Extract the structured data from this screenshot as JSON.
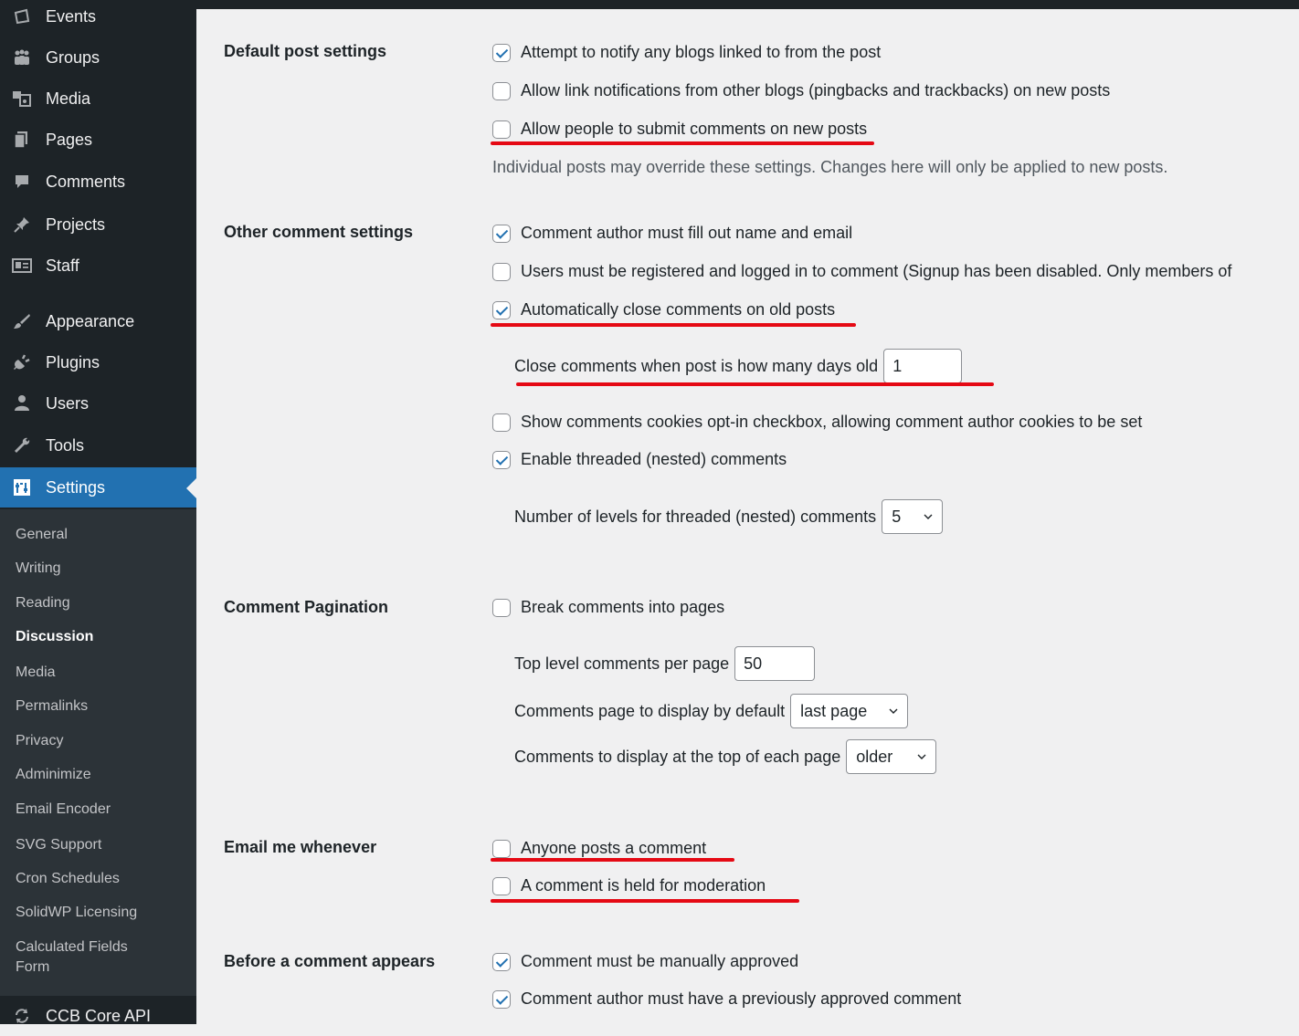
{
  "sidebar": {
    "items": [
      {
        "label": "Events",
        "icon": "calendar-icon"
      },
      {
        "label": "Groups",
        "icon": "groups-icon"
      },
      {
        "label": "Media",
        "icon": "media-icon"
      },
      {
        "label": "Pages",
        "icon": "pages-icon"
      },
      {
        "label": "Comments",
        "icon": "comments-icon"
      },
      {
        "label": "Projects",
        "icon": "pin-icon"
      },
      {
        "label": "Staff",
        "icon": "id-card-icon"
      },
      {
        "label": "Appearance",
        "icon": "paintbrush-icon"
      },
      {
        "label": "Plugins",
        "icon": "plugin-icon"
      },
      {
        "label": "Users",
        "icon": "user-icon"
      },
      {
        "label": "Tools",
        "icon": "wrench-icon"
      },
      {
        "label": "Settings",
        "icon": "settings-icon"
      },
      {
        "label": "CCB Core API",
        "icon": "sync-icon"
      }
    ],
    "submenu": [
      "General",
      "Writing",
      "Reading",
      "Discussion",
      "Media",
      "Permalinks",
      "Privacy",
      "Adminimize",
      "Email Encoder",
      "SVG Support",
      "Cron Schedules",
      "SolidWP Licensing",
      "Calculated Fields",
      "Form"
    ],
    "active_item": "Settings",
    "current_sub": "Discussion"
  },
  "sections": {
    "default_post": {
      "title": "Default post settings",
      "opt1": "Attempt to notify any blogs linked to from the post",
      "opt2": "Allow link notifications from other blogs (pingbacks and trackbacks) on new posts",
      "opt3": "Allow people to submit comments on new posts",
      "desc": "Individual posts may override these settings. Changes here will only be applied to new posts."
    },
    "other": {
      "title": "Other comment settings",
      "opt1": "Comment author must fill out name and email",
      "opt2": "Users must be registered and logged in to comment (Signup has been disabled. Only members of",
      "opt3": "Automatically close comments on old posts",
      "close_label": "Close comments when post is how many days old",
      "close_value": "1",
      "opt4": "Show comments cookies opt-in checkbox, allowing comment author cookies to be set",
      "opt5": "Enable threaded (nested) comments",
      "levels_label": "Number of levels for threaded (nested) comments",
      "levels_value": "5"
    },
    "pagination": {
      "title": "Comment Pagination",
      "opt1": "Break comments into pages",
      "per_page_label": "Top level comments per page",
      "per_page_value": "50",
      "default_page_label": "Comments page to display by default",
      "default_page_value": "last page",
      "top_label": "Comments to display at the top of each page",
      "top_value": "older"
    },
    "email": {
      "title": "Email me whenever",
      "opt1": "Anyone posts a comment",
      "opt2": "A comment is held for moderation"
    },
    "before": {
      "title": "Before a comment appears",
      "opt1": "Comment must be manually approved",
      "opt2": "Comment author must have a previously approved comment"
    }
  },
  "checkbox_states": {
    "notify_blogs": true,
    "pingbacks": false,
    "allow_comments": false,
    "name_email": true,
    "registered": false,
    "auto_close": true,
    "cookies": false,
    "threaded": true,
    "paginate": false,
    "email_posts": false,
    "email_moderation": false,
    "manual_approve": true,
    "prev_approved": true
  },
  "colors": {
    "sidebar": "#1d2327",
    "submenu": "#2c3338",
    "accent": "#2271b1",
    "highlight": "#e50914"
  }
}
